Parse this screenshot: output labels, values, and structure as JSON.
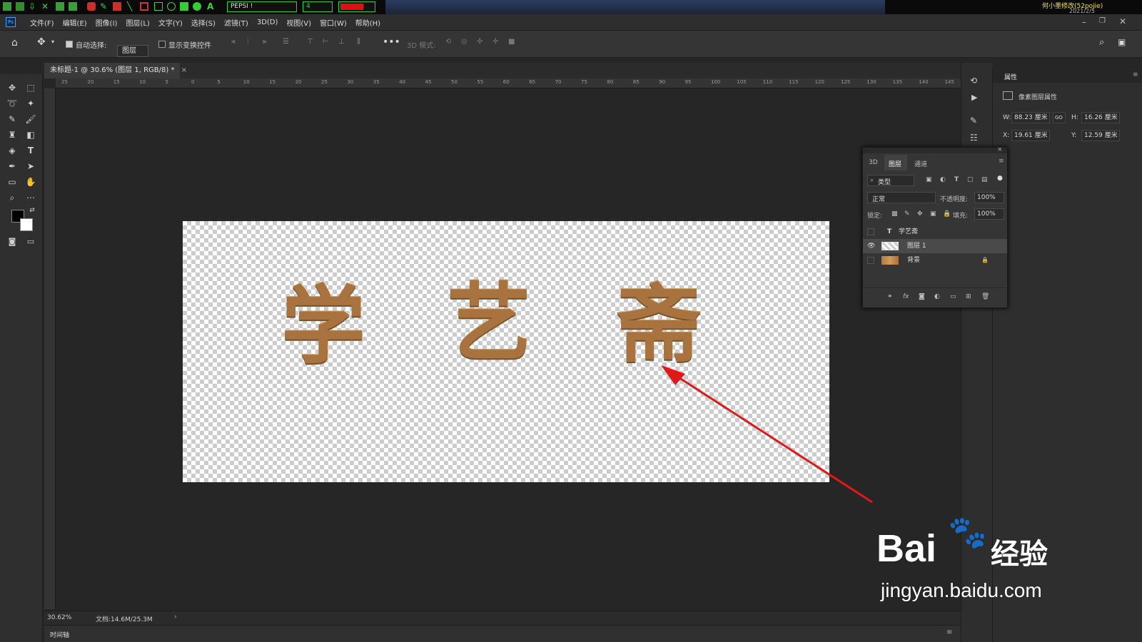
{
  "os_bar": {
    "font_name": "PEPSI !",
    "size_value": "4",
    "user_label": "何小墨修改(52pojie)",
    "date": "2021/2/5"
  },
  "menubar": {
    "app_badge": "Ps",
    "items": [
      "文件(F)",
      "编辑(E)",
      "图像(I)",
      "图层(L)",
      "文字(Y)",
      "选择(S)",
      "滤镜(T)",
      "3D(D)",
      "视图(V)",
      "窗口(W)",
      "帮助(H)"
    ]
  },
  "options": {
    "auto_select": "自动选择:",
    "auto_select_target": "图层",
    "show_transform": "显示变换控件",
    "mode_3d": "3D 模式:"
  },
  "document": {
    "tab_title": "未标题-1 @ 30.6% (图层 1, RGB/8) *",
    "ruler_top": [
      "25",
      "20",
      "15",
      "10",
      "5",
      "0",
      "5",
      "10",
      "15",
      "20",
      "25",
      "30",
      "35",
      "40",
      "45",
      "50",
      "55",
      "60",
      "65",
      "70",
      "75",
      "80",
      "85",
      "90",
      "95",
      "100",
      "105",
      "110",
      "115",
      "120",
      "125",
      "130",
      "135",
      "140",
      "145"
    ],
    "canvas_text": [
      "学",
      "艺",
      "斋"
    ]
  },
  "status": {
    "zoom": "30.62%",
    "doc_size": "文档:14.6M/25.3M"
  },
  "timeline": {
    "label": "时间轴"
  },
  "properties": {
    "tab": "属性",
    "heading": "像素图层属性",
    "w_label": "W:",
    "w_value": "88.23 厘米",
    "h_label": "H:",
    "h_value": "16.26 厘米",
    "x_label": "X:",
    "x_value": "19.61 厘米",
    "y_label": "Y:",
    "y_value": "12.59 厘米",
    "link_label": "GO"
  },
  "layers_panel": {
    "tabs": [
      "3D",
      "图层",
      "通道"
    ],
    "filter": "类型",
    "blend_mode": "正常",
    "opacity_label": "不透明度:",
    "opacity_value": "100%",
    "lock_label": "锁定:",
    "fill_label": "填充:",
    "fill_value": "100%",
    "layers": [
      {
        "name": "学艺斋",
        "kind": "text",
        "visible": false
      },
      {
        "name": "图层 1",
        "kind": "pixel",
        "visible": true,
        "selected": true
      },
      {
        "name": "背景",
        "kind": "pixel",
        "visible": false,
        "locked": true
      }
    ]
  },
  "watermark": {
    "brand_a": "Bai",
    "brand_b": "经验",
    "url": "jingyan.baidu.com"
  },
  "colors": {
    "wood": "#a8733e",
    "arrow": "#e11818",
    "panel": "#353535"
  }
}
